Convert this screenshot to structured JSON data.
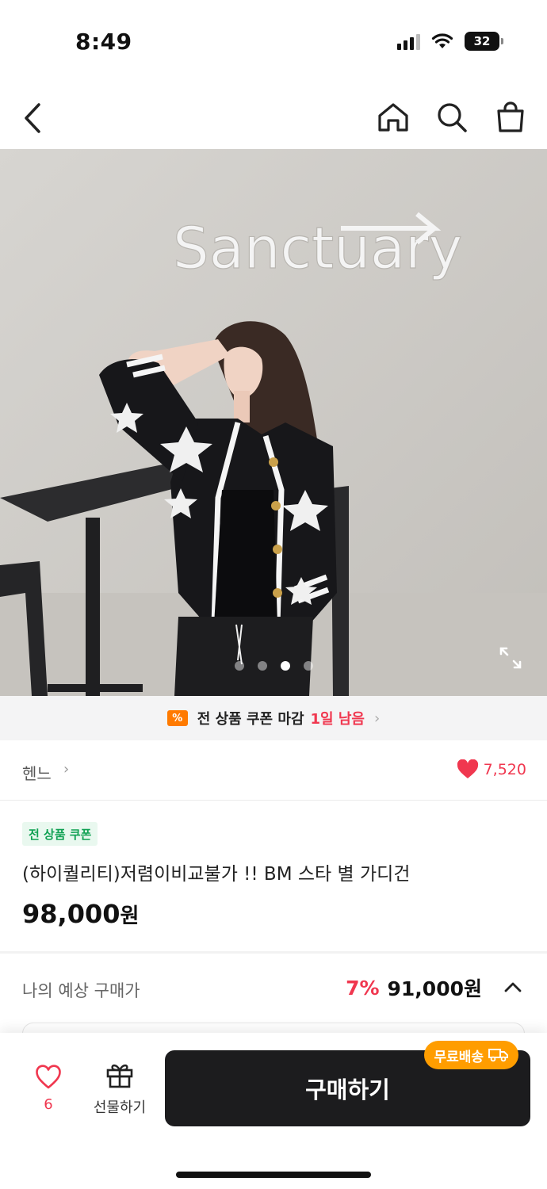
{
  "status_bar": {
    "time": "8:49",
    "battery": "32",
    "icons": [
      "signal-icon",
      "wifi-icon",
      "battery-icon"
    ]
  },
  "nav": {
    "icons": [
      "back-arrow-icon",
      "home-icon",
      "search-icon",
      "shopping-bag-icon"
    ]
  },
  "hero": {
    "wall_sign": "Sanctuary",
    "slide_count": 4,
    "active_slide": 3,
    "icon": "expand-icon"
  },
  "coupon_banner": {
    "badge": "%",
    "text": "전 상품 쿠폰 마감",
    "highlight": "1일 남음",
    "arrow": "›"
  },
  "brand": {
    "name": "헨느",
    "arrow": "›",
    "likes": "7,520"
  },
  "product": {
    "coupon_tag": "전 상품 쿠폰",
    "title": "(하이퀄리티)저렴이비교불가 !! BM 스타 별 가디건",
    "price": "98,000",
    "currency": "원"
  },
  "estimate": {
    "label": "나의 예상 구매가",
    "discount": "7%",
    "price": "91,000원"
  },
  "bottom_bar": {
    "wish_count": "6",
    "gift_label": "선물하기",
    "buy_label": "구매하기",
    "shipping_badge": "무료배송"
  },
  "colors": {
    "accent": "#f0374f",
    "coupon_orange": "#ff7a00",
    "shipping_orange": "#ff9d00",
    "coupon_green": "#10a153",
    "buy_button": "#1c1c1e"
  }
}
